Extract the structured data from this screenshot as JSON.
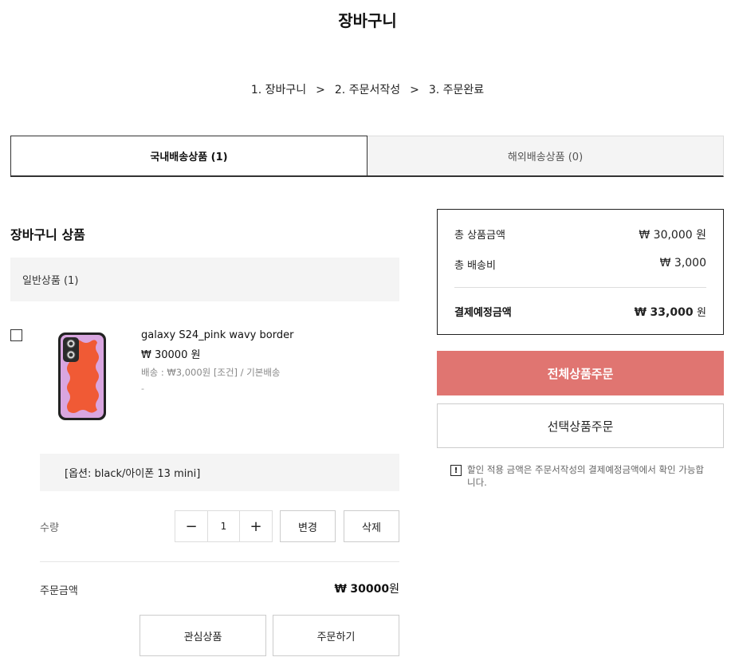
{
  "page_title": "장바구니",
  "steps": [
    "1. 장바구니",
    "2. 주문서작성",
    "3. 주문완료"
  ],
  "step_separator": ">",
  "tabs": [
    {
      "label": "국내배송상품 (1)"
    },
    {
      "label": "해외배송상품 (0)"
    }
  ],
  "cart": {
    "section_title": "장바구니 상품",
    "group_label": "일반상품 (1)",
    "item": {
      "name": "galaxy S24_pink wavy border",
      "price": "₩ 30000 원",
      "shipping": "배송 : ₩3,000원 [조건] / 기본배송",
      "extra": "-",
      "option": "[옵션: black/아이폰 13 mini]",
      "image_icon": "phone-case-image"
    },
    "quantity_label": "수량",
    "quantity": "1",
    "minus_symbol": "−",
    "plus_symbol": "+",
    "change_label": "변경",
    "delete_label": "삭제",
    "order_amount_label": "주문금액",
    "order_amount_currency": "₩",
    "order_amount_value": "30000",
    "order_amount_unit": "원",
    "wishlist_label": "관심상품",
    "order_label": "주문하기"
  },
  "summary": {
    "product_total_label": "총 상품금액",
    "product_total_value": "₩ 30,000 원",
    "shipping_label": "총 배송비",
    "shipping_value": "₩ 3,000",
    "expected_label": "결제예정금액",
    "expected_currency": "₩",
    "expected_amount": "33,000",
    "expected_unit": "원"
  },
  "buttons": {
    "order_all": "전체상품주문",
    "order_selected": "선택상품주문"
  },
  "notice": {
    "icon": "!",
    "text": "할인 적용 금액은 주문서작성의 결제예정금액에서 확인 가능합니다."
  },
  "colors": {
    "primary": "#e07571",
    "case_pink": "#d9a6e0",
    "case_orange": "#f05a35"
  }
}
